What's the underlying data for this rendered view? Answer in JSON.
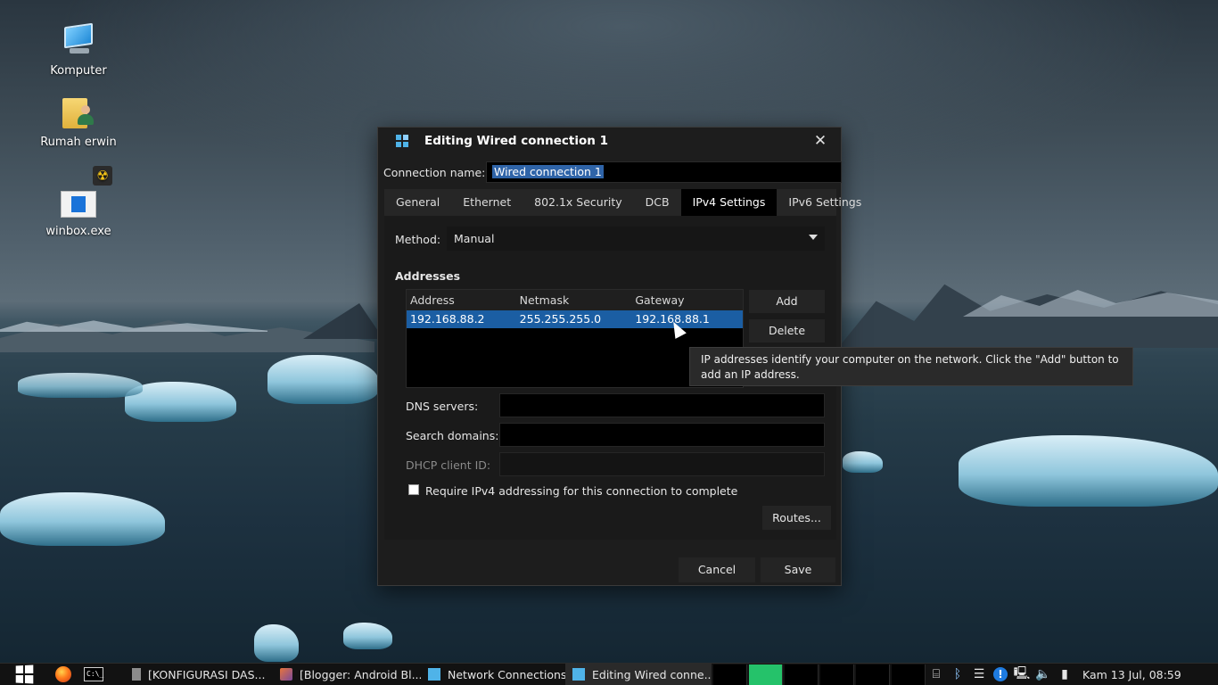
{
  "desktop": {
    "icons": [
      {
        "label": "Komputer"
      },
      {
        "label": "Rumah erwin"
      },
      {
        "label": "winbox.exe"
      }
    ]
  },
  "dialog": {
    "title": "Editing Wired connection 1",
    "close_glyph": "✕",
    "connection_name_label": "Connection name:",
    "connection_name_value": "Wired connection 1",
    "tabs": [
      {
        "label": "General"
      },
      {
        "label": "Ethernet"
      },
      {
        "label": "802.1x Security"
      },
      {
        "label": "DCB"
      },
      {
        "label": "IPv4 Settings",
        "active": true
      },
      {
        "label": "IPv6 Settings"
      }
    ],
    "method_label": "Method:",
    "method_value": "Manual",
    "addresses_title": "Addresses",
    "table": {
      "headers": [
        "Address",
        "Netmask",
        "Gateway"
      ],
      "rows": [
        [
          "192.168.88.2",
          "255.255.255.0",
          "192.168.88.1"
        ]
      ]
    },
    "add_label": "Add",
    "delete_label": "Delete",
    "dns_label": "DNS servers:",
    "dns_value": "",
    "search_domains_label": "Search domains:",
    "search_domains_value": "",
    "dhcp_label": "DHCP client ID:",
    "dhcp_value": "",
    "require_ipv4_label": "Require IPv4 addressing for this connection to complete",
    "require_ipv4_checked": false,
    "routes_label": "Routes...",
    "cancel_label": "Cancel",
    "save_label": "Save",
    "tooltip": "IP addresses identify your computer on the network.  Click the \"Add\" button to add an IP address."
  },
  "taskbar": {
    "tasks": [
      {
        "label": "[KONFIGURASI DAS..."
      },
      {
        "label": "[Blogger: Android Bl..."
      },
      {
        "label": "Network Connections"
      },
      {
        "label": "Editing Wired conne...",
        "active": true
      }
    ],
    "tray_icons": [
      "network-cable-icon",
      "bluetooth-icon",
      "menu-icon",
      "alert-icon",
      "network-icon",
      "volume-icon",
      "battery-icon"
    ],
    "clock": "Kam 13 Jul, 08:59"
  },
  "colors": {
    "selection": "#1b5ea3",
    "dialog_bg": "#1d1d1d",
    "active_monitor": "#25c26a"
  }
}
